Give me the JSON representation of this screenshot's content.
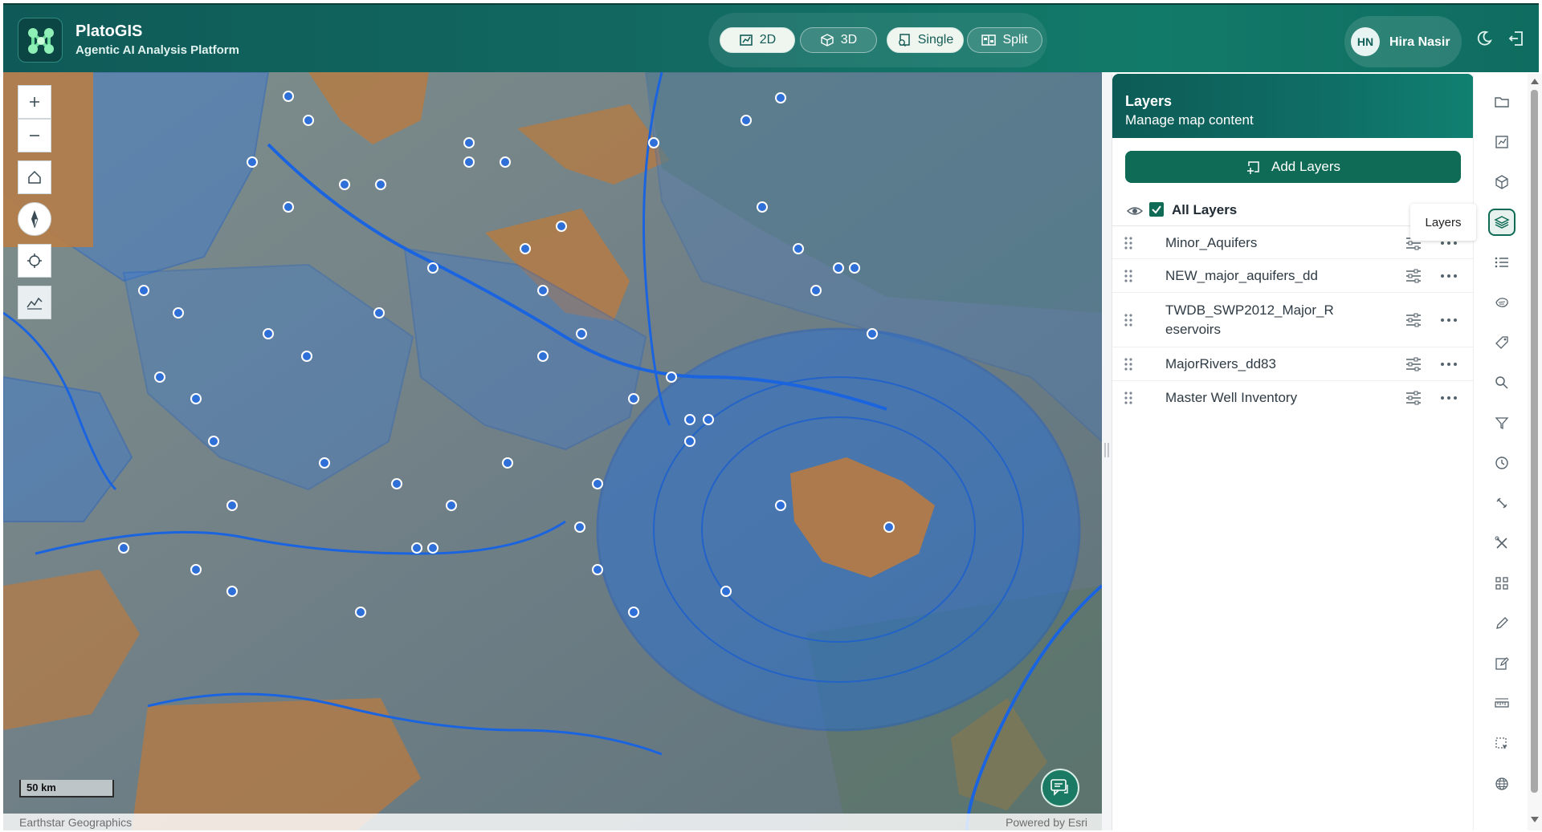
{
  "app": {
    "title": "PlatoGIS",
    "subtitle": "Agentic AI Analysis Platform",
    "logo_icon": "network-nodes-icon"
  },
  "view_modes": [
    {
      "label": "2D",
      "icon": "map-2d-icon",
      "active": true
    },
    {
      "label": "3D",
      "icon": "cube-icon",
      "active": false
    },
    {
      "label": "Single",
      "icon": "single-view-icon",
      "active": true
    },
    {
      "label": "Split",
      "icon": "split-view-icon",
      "active": false
    }
  ],
  "user": {
    "initials": "HN",
    "name": "Hira Nasir",
    "theme_icon": "moon-icon",
    "logout_icon": "logout-icon"
  },
  "map": {
    "scale_label": "50 km",
    "attribution_left": "Earthstar Geographics",
    "attribution_right": "Powered by Esri",
    "controls": [
      "zoom-in",
      "zoom-out",
      "home",
      "compass",
      "locate",
      "elevation-profile"
    ],
    "colors": {
      "polygon_fill": "#3a7bd5",
      "polygon_stroke": "#1a5fd0",
      "point_fill": "#2e6fd8",
      "imagery_tan": "#b47b45"
    }
  },
  "panel": {
    "title": "Layers",
    "subtitle": "Manage map content",
    "add_button_label": "Add Layers",
    "all_layers_label": "All Layers",
    "all_layers_checked": true,
    "layers": [
      {
        "name": "Minor_Aquifers"
      },
      {
        "name": "NEW_major_aquifers_dd"
      },
      {
        "name": "TWDB_SWP2012_Major_Reservoirs"
      },
      {
        "name": "MajorRivers_dd83"
      },
      {
        "name": "Master Well Inventory"
      }
    ]
  },
  "rail": {
    "tooltip": "Layers",
    "active": "layers",
    "tools": [
      "folder",
      "map-2d",
      "cube",
      "layers",
      "legend-list",
      "basemap",
      "tag",
      "search",
      "filter",
      "history",
      "link",
      "tools",
      "qr-grid",
      "pencil",
      "edit",
      "measure",
      "select",
      "globe"
    ]
  },
  "accent": "#0f6b55"
}
